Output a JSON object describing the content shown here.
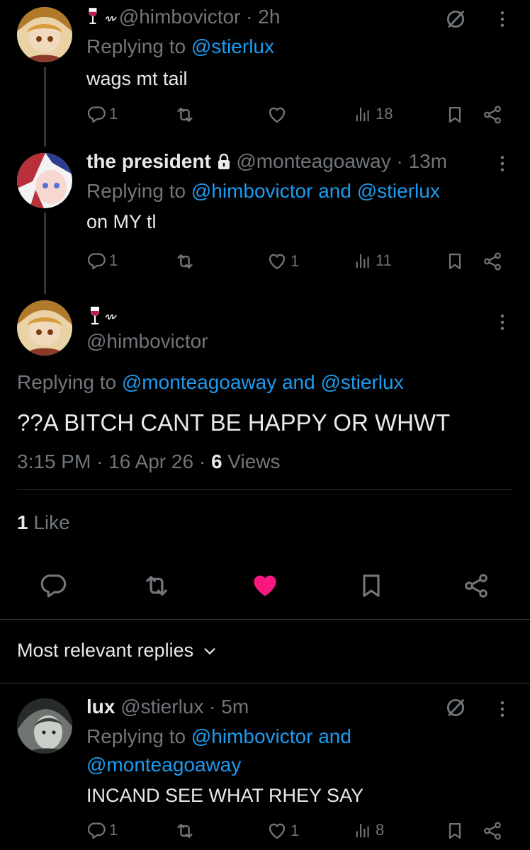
{
  "colors": {
    "accent": "#1d9bf0",
    "like": "#f91880",
    "text": "#e7e9ea",
    "muted": "#71767b"
  },
  "tweet1": {
    "handle": "@himbovictor",
    "time": "· 2h",
    "reply_prefix": "Replying to ",
    "reply_handles": "@stierlux",
    "text": "wags mt tail",
    "replies": "1",
    "views": "18"
  },
  "tweet2": {
    "name": "the president",
    "handle": "@monteagoaway",
    "time": "· 13m",
    "reply_prefix": "Replying to ",
    "reply_handles": "@himbovictor and @stierlux",
    "text": "on MY tl",
    "replies": "1",
    "likes": "1",
    "views": "11"
  },
  "main": {
    "handle": "@himbovictor",
    "reply_prefix": "Replying to ",
    "reply_handles": "@monteagoaway and @stierlux",
    "text": "??A BITCH CANT BE HAPPY OR WHWT",
    "time": "3:15 PM",
    "sep": "·",
    "date": "16 Apr 26",
    "views_count": "6",
    "views_label": " Views",
    "likes_count": "1",
    "likes_label": " Like"
  },
  "sort": {
    "label": "Most relevant replies"
  },
  "tweet3": {
    "name": "lux",
    "handle": "@stierlux",
    "time": "· 5m",
    "reply_prefix": "Replying to ",
    "reply_handles_1": "@himbovictor and",
    "reply_handles_2": "@monteagoaway",
    "text": "INCAND SEE WHAT RHEY SAY",
    "replies": "1",
    "likes": "1",
    "views": "8"
  }
}
